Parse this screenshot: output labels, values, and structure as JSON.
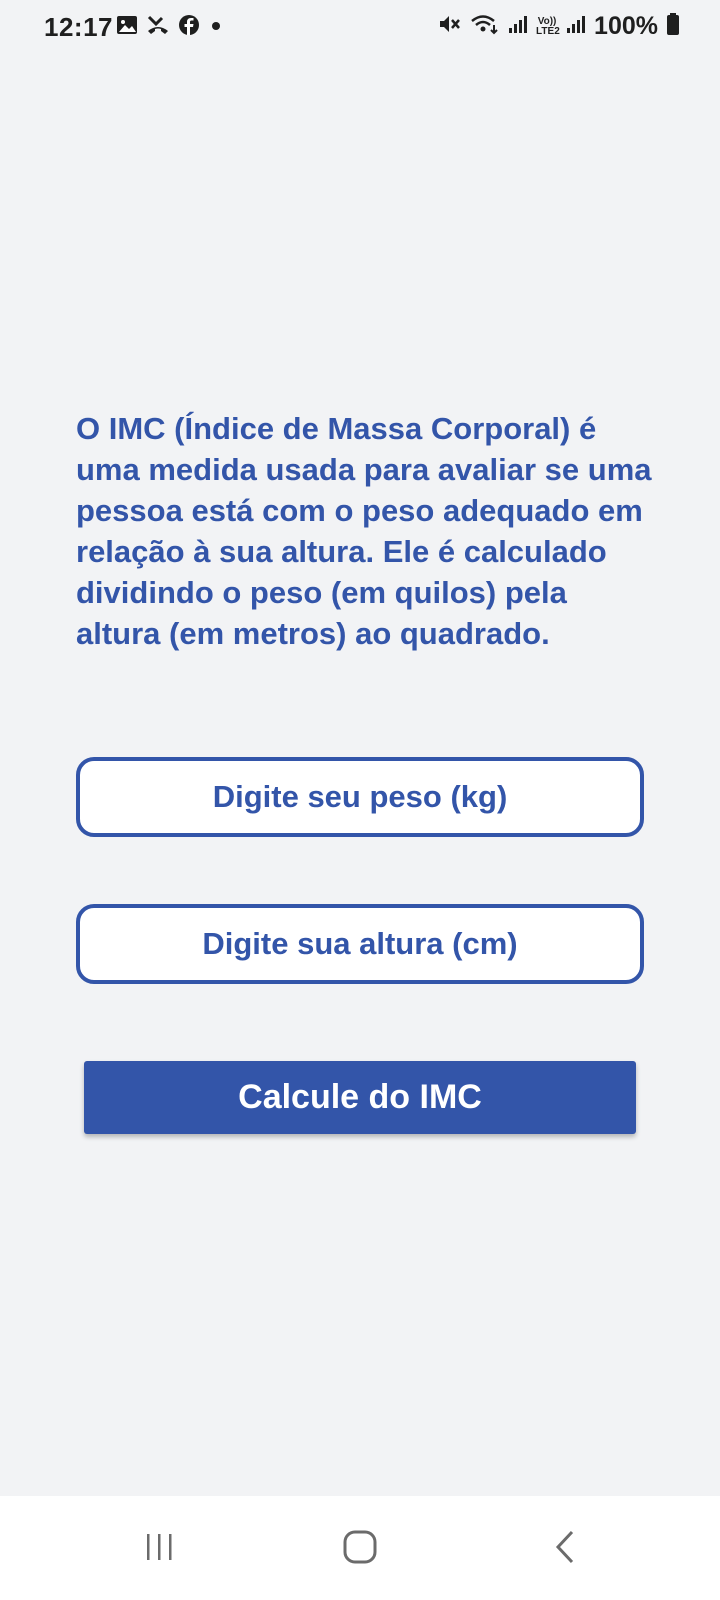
{
  "status_bar": {
    "time": "12:17",
    "left_icons": [
      "gallery-icon",
      "missed-call-icon",
      "facebook-icon",
      "dot-icon"
    ],
    "right_icons": [
      "mute-icon",
      "wifi-icon",
      "signal-icon",
      "volte-icon",
      "signal-icon"
    ],
    "volte_label_top": "Vo))",
    "volte_label_bottom": "LTE2",
    "battery": "100%"
  },
  "main": {
    "intro": "O IMC (Índice de Massa Corporal) é uma medida usada para avaliar se uma pessoa está com o peso adequado em relação à sua altura. Ele é calculado dividindo o peso (em quilos) pela altura (em metros) ao quadrado.",
    "weight_input": {
      "placeholder": "Digite seu peso (kg)",
      "value": ""
    },
    "height_input": {
      "placeholder": "Digite sua altura (cm)",
      "value": ""
    },
    "calculate_label": "Calcule do IMC"
  },
  "nav_bar": {
    "buttons": [
      "recent-apps-icon",
      "home-icon",
      "back-icon"
    ]
  },
  "colors": {
    "accent": "#3355a9",
    "background": "#f2f3f5"
  }
}
